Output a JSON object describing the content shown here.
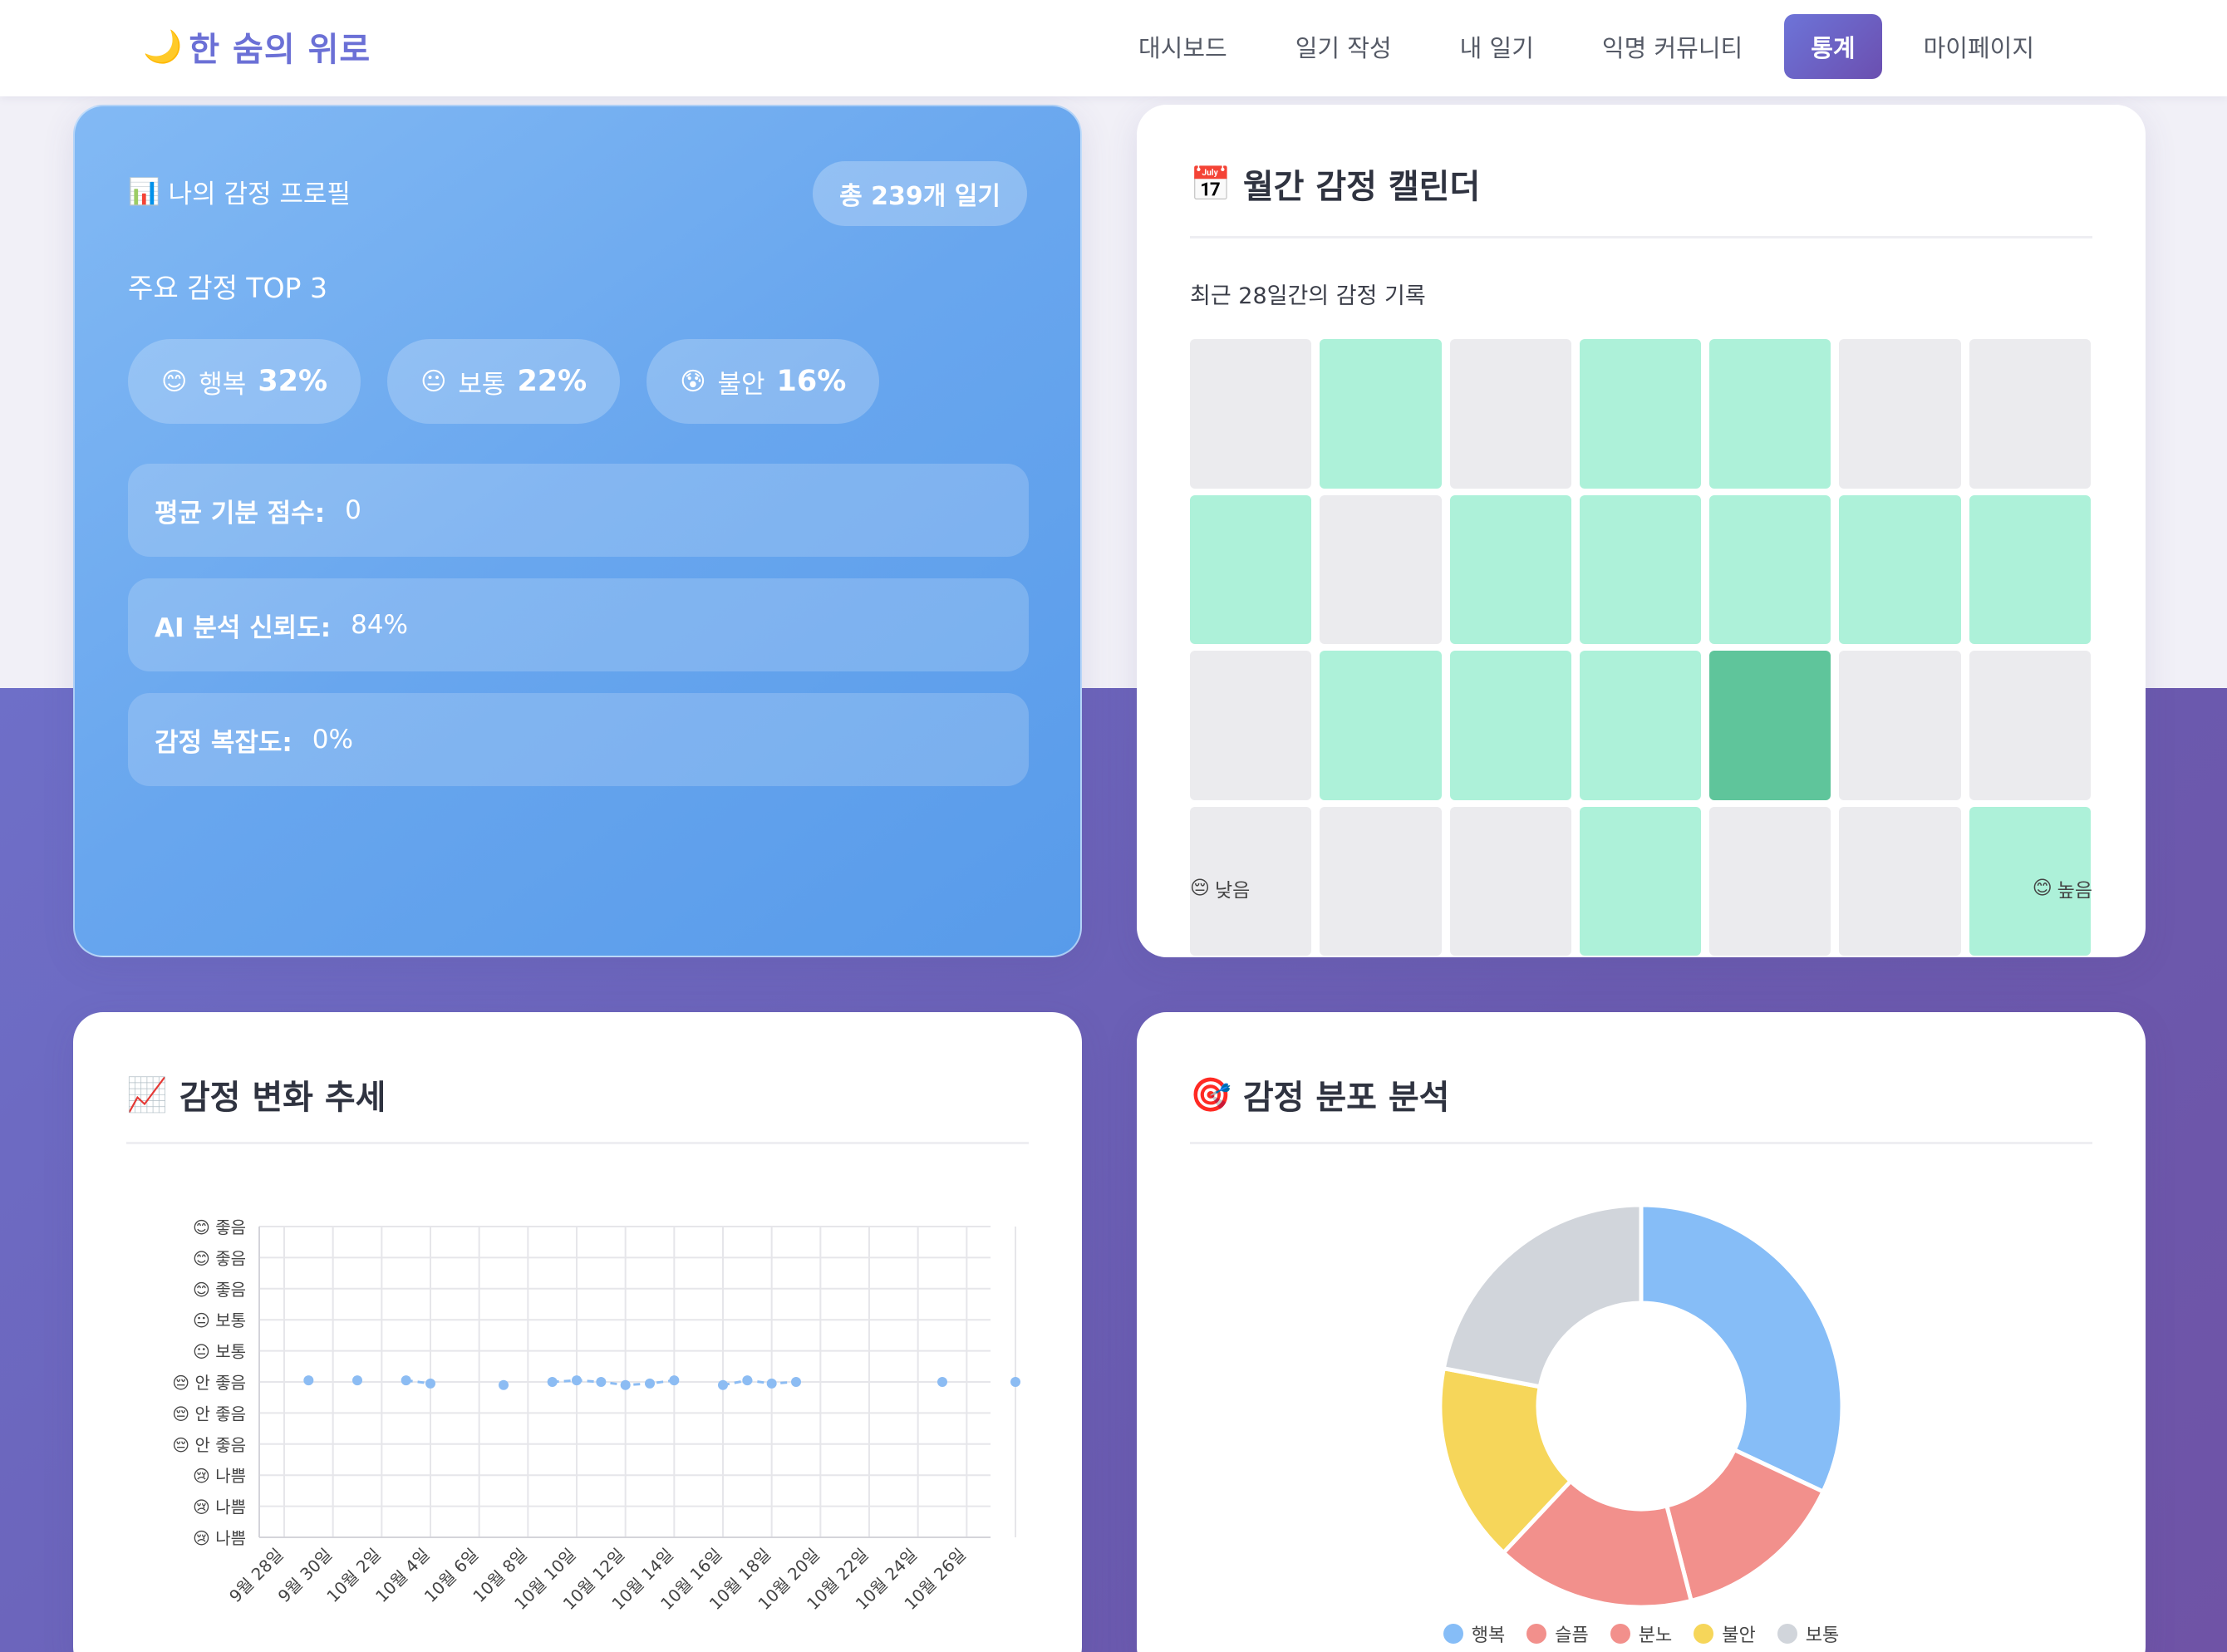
{
  "app": {
    "logo_icon": "🌙",
    "logo_text": "한 숨의 위로"
  },
  "nav": {
    "items": [
      {
        "label": "대시보드",
        "active": false
      },
      {
        "label": "일기 작성",
        "active": false
      },
      {
        "label": "내 일기",
        "active": false
      },
      {
        "label": "익명 커뮤니티",
        "active": false
      },
      {
        "label": "통계",
        "active": true
      },
      {
        "label": "마이페이지",
        "active": false
      }
    ]
  },
  "profile": {
    "title_icon": "📊",
    "title": "나의 감정 프로필",
    "total_badge": "총 239개 일기",
    "top_label": "주요 감정 TOP 3",
    "top_emotions": [
      {
        "emoji": "😊",
        "label": "행복",
        "percent": "32%"
      },
      {
        "emoji": "😐",
        "label": "보통",
        "percent": "22%"
      },
      {
        "emoji": "😰",
        "label": "불안",
        "percent": "16%"
      }
    ],
    "stats": [
      {
        "label": "평균 기분 점수:",
        "value": "0"
      },
      {
        "label": "AI 분석 신뢰도:",
        "value": "84%"
      },
      {
        "label": "감정 복잡도:",
        "value": "0%"
      }
    ]
  },
  "calendar": {
    "title_icon": "📅",
    "title": "월간 감정 캘린더",
    "subtitle": "최근 28일간의 감정 기록",
    "levels": [
      0,
      1,
      0,
      1,
      1,
      0,
      0,
      1,
      0,
      1,
      1,
      1,
      1,
      1,
      0,
      1,
      1,
      1,
      2,
      0,
      0,
      0,
      0,
      0,
      1,
      0,
      0,
      1
    ],
    "legend_low_emoji": "😔",
    "legend_low": "낮음",
    "legend_high_emoji": "😊",
    "legend_high": "높음"
  },
  "trend": {
    "title_icon": "📈",
    "title": "감정 변화 추세"
  },
  "distribution": {
    "title_icon": "🎯",
    "title": "감정 분포 분석"
  },
  "chart_data": [
    {
      "type": "line",
      "title": "감정 변화 추세",
      "y_tick_labels": [
        {
          "emoji": "😊",
          "label": "좋음"
        },
        {
          "emoji": "😊",
          "label": "좋음"
        },
        {
          "emoji": "😊",
          "label": "좋음"
        },
        {
          "emoji": "😐",
          "label": "보통"
        },
        {
          "emoji": "😐",
          "label": "보통"
        },
        {
          "emoji": "😔",
          "label": "안 좋음"
        },
        {
          "emoji": "😔",
          "label": "안 좋음"
        },
        {
          "emoji": "😔",
          "label": "안 좋음"
        },
        {
          "emoji": "😢",
          "label": "나쁨"
        },
        {
          "emoji": "😢",
          "label": "나쁨"
        },
        {
          "emoji": "😢",
          "label": "나쁨"
        }
      ],
      "x_tick_labels": [
        "9월 28일",
        "9월 30일",
        "10월 2일",
        "10월 4일",
        "10월 6일",
        "10월 8일",
        "10월 10일",
        "10월 12일",
        "10월 14일",
        "10월 16일",
        "10월 18일",
        "10월 20일",
        "10월 22일",
        "10월 24일",
        "10월 26일"
      ],
      "ylim": [
        -5,
        5
      ],
      "x": [
        "9월 29일",
        "10월 1일",
        "10월 3일",
        "10월 4일",
        "10월 7일",
        "10월 9일",
        "10월 10일",
        "10월 11일",
        "10월 12일",
        "10월 13일",
        "10월 14일",
        "10월 16일",
        "10월 17일",
        "10월 18일",
        "10월 19일",
        "10월 25일",
        "10월 28일"
      ],
      "values": [
        0.05,
        0.05,
        0.05,
        -0.05,
        -0.1,
        0.0,
        0.05,
        0.0,
        -0.1,
        -0.05,
        0.05,
        -0.1,
        0.05,
        -0.05,
        0.0,
        0.0,
        0.0
      ],
      "segments": [
        [
          2,
          3
        ],
        [
          5,
          10
        ],
        [
          11,
          14
        ]
      ],
      "color": "#8cbcf3",
      "grid": true
    },
    {
      "type": "pie",
      "title": "감정 분포 분석",
      "donut": true,
      "labels": [
        "행복",
        "슬픔",
        "분노",
        "불안",
        "보통"
      ],
      "values": [
        32,
        14,
        16,
        16,
        22
      ],
      "colors": [
        "#86bdf7",
        "#f2908c",
        "#f2908c",
        "#f6d65a",
        "#d1d5db"
      ],
      "legend": "bottom"
    }
  ]
}
